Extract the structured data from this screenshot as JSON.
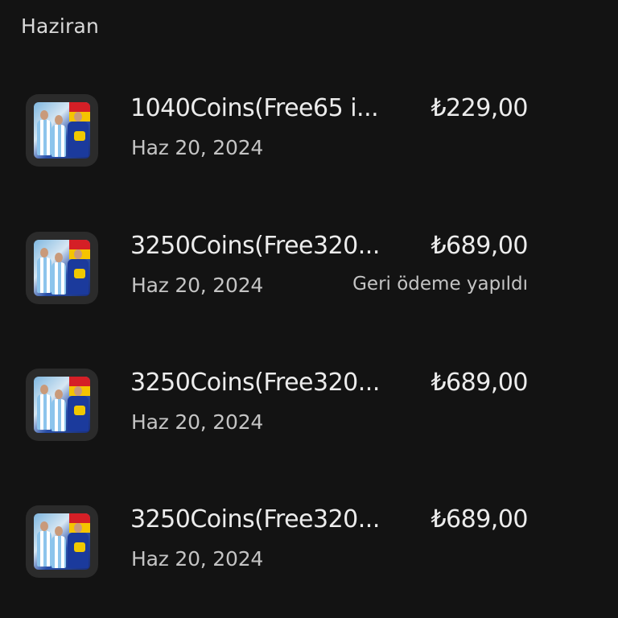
{
  "section": {
    "title": "Haziran"
  },
  "purchases": [
    {
      "title": "1040Coins(Free65 i...",
      "date": "Haz 20, 2024",
      "price": "₺229,00",
      "status": "",
      "icon": "game-app-icon"
    },
    {
      "title": "3250Coins(Free320...",
      "date": "Haz 20, 2024",
      "price": "₺689,00",
      "status": "Geri ödeme yapıldı",
      "icon": "game-app-icon"
    },
    {
      "title": "3250Coins(Free320...",
      "date": "Haz 20, 2024",
      "price": "₺689,00",
      "status": "",
      "icon": "game-app-icon"
    },
    {
      "title": "3250Coins(Free320...",
      "date": "Haz 20, 2024",
      "price": "₺689,00",
      "status": "",
      "icon": "game-app-icon"
    }
  ],
  "colors": {
    "background": "#131313",
    "primary_text": "#ececec",
    "secondary_text": "#c4c4c4",
    "icon_tile": "#2b2b2b"
  }
}
